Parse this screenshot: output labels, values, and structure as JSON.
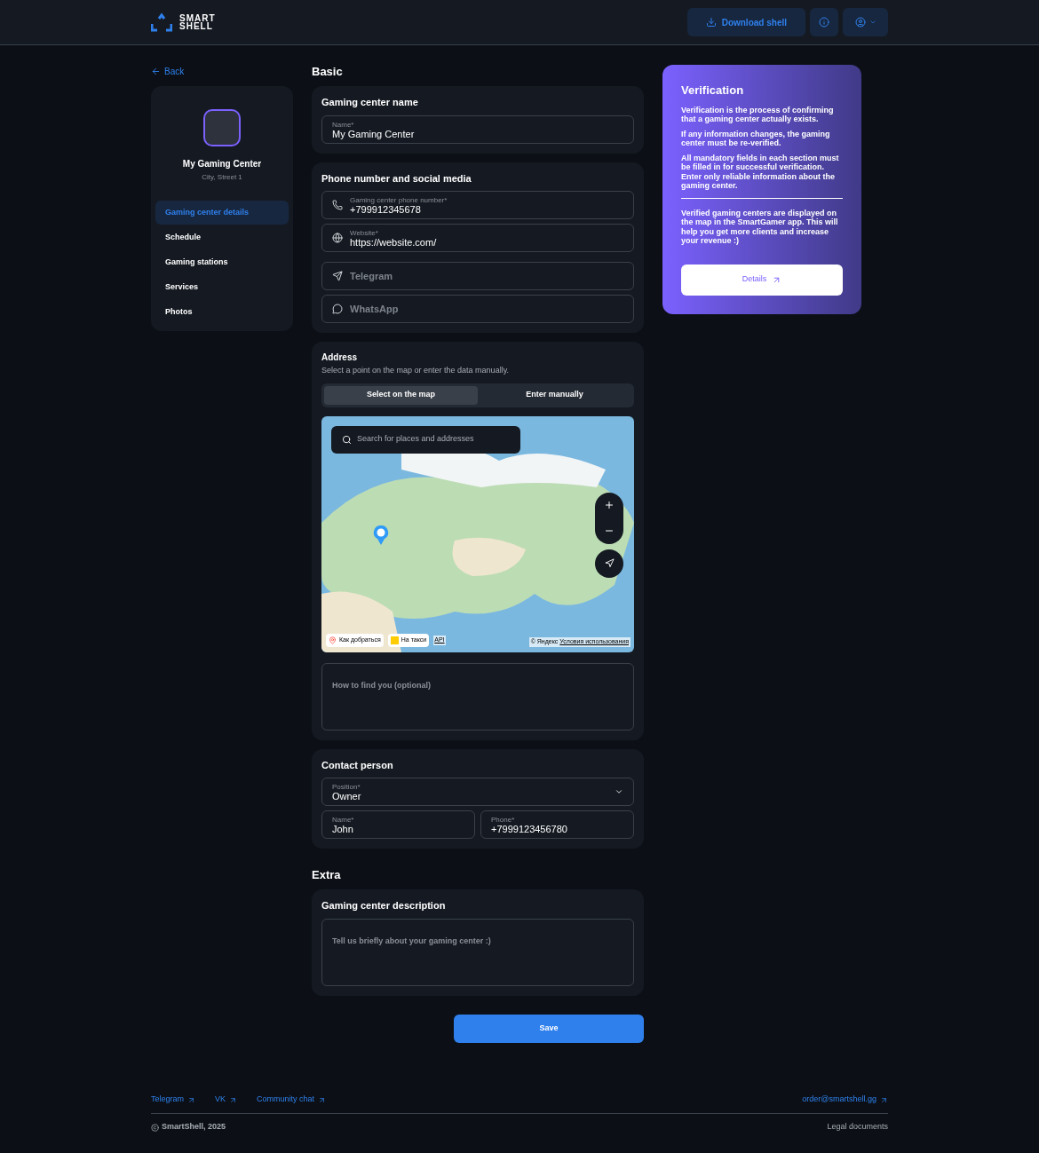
{
  "header": {
    "logo_lines": [
      "SMART",
      "SHELL"
    ],
    "download_button": "Download shell"
  },
  "sidebar": {
    "back": "Back",
    "profile": {
      "name": "My Gaming Center",
      "address": "City, Street 1"
    },
    "items": [
      {
        "label": "Gaming center details",
        "selected": true
      },
      {
        "label": "Schedule",
        "selected": false
      },
      {
        "label": "Gaming stations",
        "selected": false
      },
      {
        "label": "Services",
        "selected": false
      },
      {
        "label": "Photos",
        "selected": false
      }
    ]
  },
  "basic": {
    "title": "Basic",
    "name_card": {
      "title": "Gaming center name",
      "field": {
        "label": "Name*",
        "value": "My Gaming Center"
      }
    },
    "contacts_card": {
      "title": "Phone number and social media",
      "fields": [
        {
          "kind": "phone",
          "label": "Gaming center phone number*",
          "value": "+799912345678"
        },
        {
          "kind": "website",
          "label": "Website*",
          "value": "https://website.com/"
        },
        {
          "kind": "telegram",
          "placeholder": "Telegram"
        },
        {
          "kind": "whatsapp",
          "placeholder": "WhatsApp"
        }
      ]
    },
    "address_card": {
      "title": "Address",
      "subtitle": "Select a point on the map or enter the data manually.",
      "tabs": [
        {
          "label": "Select on the map",
          "selected": true
        },
        {
          "label": "Enter manually",
          "selected": false
        }
      ],
      "map": {
        "search_placeholder": "Search for places and addresses",
        "route_button": "Как добраться",
        "taxi_button": "На такси",
        "api_link": "API",
        "copyright": "© Яндекс",
        "terms_link": "Условия использования"
      },
      "directions": {
        "placeholder": "How to find you (optional)"
      }
    },
    "contact_card": {
      "title": "Contact person",
      "position": {
        "label": "Position*",
        "value": "Owner"
      },
      "name": {
        "label": "Name*",
        "value": "John"
      },
      "phone": {
        "label": "Phone*",
        "value": "+7999123456780"
      }
    }
  },
  "extra": {
    "title": "Extra",
    "description_card": {
      "title": "Gaming center description",
      "placeholder": "Tell us briefly about your gaming center :)"
    }
  },
  "save_button": "Save",
  "verification": {
    "title": "Verification",
    "paragraphs": [
      "Verification is the process of confirming that a gaming center actually exists.",
      "If any information changes, the gaming center must be re-verified.",
      "All mandatory fields in each section must be filled in for successful verification. Enter only reliable information about the gaming center."
    ],
    "note": "Verified gaming centers are displayed on the map in the SmartGamer app. This will help you get more clients and increase your revenue :)",
    "details_button": "Details"
  },
  "footer": {
    "links": [
      "Telegram",
      "VK",
      "Community chat"
    ],
    "email": "order@smartshell.gg",
    "copyright": "SmartShell, 2025",
    "legal": "Legal documents"
  }
}
